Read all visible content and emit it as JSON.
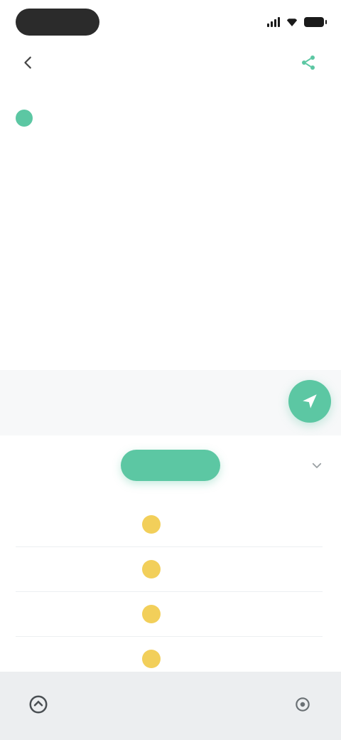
{
  "status_bar": {
    "time": "",
    "icons": [
      "signal-icon",
      "wifi-icon",
      "battery-icon"
    ]
  },
  "header": {
    "title": "",
    "back_icon": "chevron-left-icon",
    "action_icon": "share-icon"
  },
  "notice": {
    "icon": "info-icon",
    "text": "",
    "subtext": ""
  },
  "composer": {
    "placeholder": "",
    "send_icon": "send-icon"
  },
  "tabs": [
    {
      "label": "",
      "active": false
    },
    {
      "label": "",
      "active": true
    },
    {
      "label": "",
      "active": false
    }
  ],
  "tabs_more_icon": "chevron-down-icon",
  "list": {
    "header": "",
    "items": [
      {
        "left": "",
        "name": "",
        "right": ""
      },
      {
        "left": "",
        "name": "",
        "right": ""
      },
      {
        "left": "",
        "name": "",
        "right": ""
      },
      {
        "left": "",
        "name": "",
        "right": ""
      }
    ]
  },
  "bottom_bar": {
    "left_icon": "home-icon",
    "right_icon": "settings-icon"
  },
  "colors": {
    "accent": "#5cc7a3",
    "badge": "#f2cf5a",
    "bottom_bar": "#eceef0",
    "input_bar": "#f7f8f9"
  }
}
